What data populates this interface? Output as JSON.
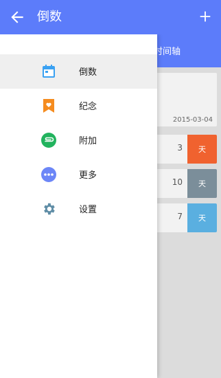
{
  "app_bar": {
    "title": "倒数",
    "back_icon": "arrow-left-icon",
    "add_icon": "plus-icon",
    "color": "#5c7cfa"
  },
  "drawer": {
    "items": [
      {
        "label": "倒数",
        "icon": "calendar-icon",
        "color": "#3aa1f2",
        "active": true
      },
      {
        "label": "纪念",
        "icon": "bookmark-heart-icon",
        "color": "#f58c1f",
        "active": false
      },
      {
        "label": "附加",
        "icon": "paperclip-icon",
        "color": "#22b35e",
        "active": false
      },
      {
        "label": "更多",
        "icon": "more-dots-icon",
        "color": "#6c86f7",
        "active": false
      },
      {
        "label": "设置",
        "icon": "gear-icon",
        "color": "#5f8da6",
        "active": false
      }
    ]
  },
  "background": {
    "tab_label": "时间轴",
    "card": {
      "date": "2015-03-04"
    },
    "rows": [
      {
        "number": "3",
        "unit": "天",
        "color": "#f0622f"
      },
      {
        "number": "10",
        "unit": "天",
        "color": "#7b8e9a"
      },
      {
        "number": "7",
        "unit": "天",
        "color": "#5aafe0"
      }
    ]
  }
}
